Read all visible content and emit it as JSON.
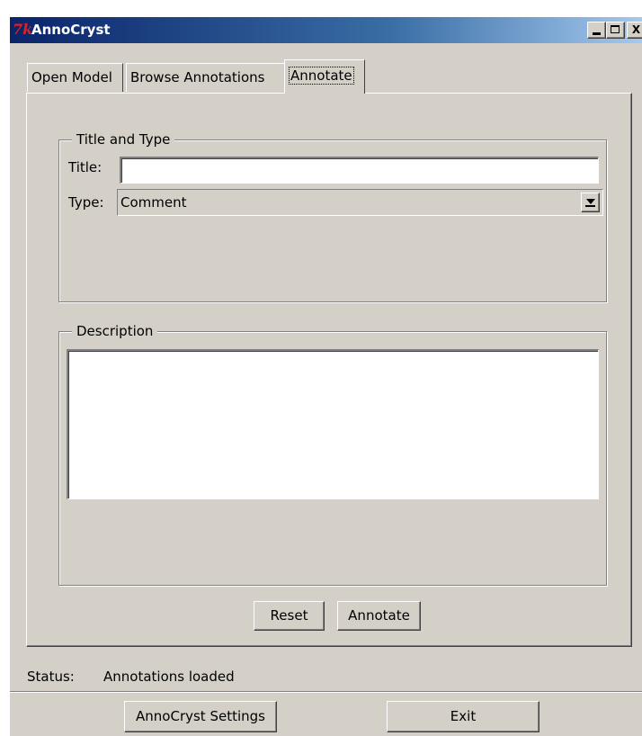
{
  "window": {
    "title": "AnnoCryst",
    "icon": "tk-icon",
    "icon_text": "7k",
    "minimize_icon": "minimize-icon",
    "maximize_icon": "maximize-icon",
    "close_icon": "close-icon",
    "close_glyph": "X"
  },
  "tabs": [
    {
      "label": "Open Model",
      "selected": false
    },
    {
      "label": "Browse Annotations",
      "selected": false
    },
    {
      "label": "Annotate",
      "selected": true
    }
  ],
  "title_and_type": {
    "group_label": "Title and Type",
    "title_label": "Title:",
    "title_value": "",
    "type_label": "Type:",
    "type_value": "Comment"
  },
  "description": {
    "group_label": "Description",
    "value": ""
  },
  "actions": {
    "reset_label": "Reset",
    "annotate_label": "Annotate"
  },
  "status": {
    "label": "Status:",
    "value": "Annotations loaded"
  },
  "footer": {
    "settings_label": "AnnoCryst Settings",
    "exit_label": "Exit"
  }
}
